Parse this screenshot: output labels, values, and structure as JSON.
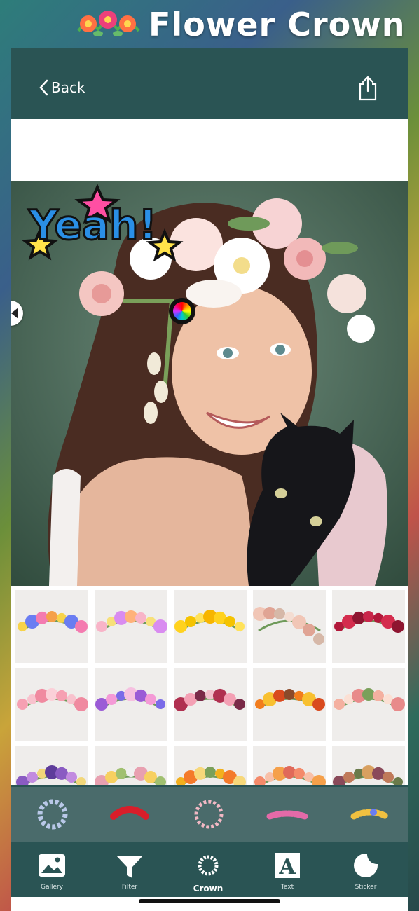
{
  "banner": {
    "title": "Flower Crown"
  },
  "header": {
    "back_label": "Back"
  },
  "colors": {
    "panel": "#2a5454",
    "category_bar": "#4a6b6b",
    "tile_bg": "#efedeb"
  },
  "icons": {
    "back": "chevron-left-icon",
    "share": "share-icon",
    "color_wheel": "color-wheel-icon",
    "handle": "caret-left-icon"
  },
  "sticker": {
    "text": "Yeah!"
  },
  "crown_grid": {
    "rows": 3,
    "columns": 5,
    "items": [
      {
        "name": "crown-mixed-blue"
      },
      {
        "name": "crown-pastel"
      },
      {
        "name": "crown-yellow"
      },
      {
        "name": "crown-pink-rose-side"
      },
      {
        "name": "crown-red-roses"
      },
      {
        "name": "crown-pink"
      },
      {
        "name": "crown-purple"
      },
      {
        "name": "crown-burgundy"
      },
      {
        "name": "crown-orange"
      },
      {
        "name": "crown-peach-roses"
      },
      {
        "name": "crown-violet"
      },
      {
        "name": "crown-wildflower"
      },
      {
        "name": "crown-sunflower"
      },
      {
        "name": "crown-coral"
      },
      {
        "name": "crown-autumn"
      }
    ]
  },
  "categories": [
    {
      "name": "blue-wreath"
    },
    {
      "name": "red-roses"
    },
    {
      "name": "pink-wreath"
    },
    {
      "name": "pastel-band"
    },
    {
      "name": "mixed-band"
    }
  ],
  "tabs": [
    {
      "label": "Gallery",
      "icon": "image-icon",
      "active": false
    },
    {
      "label": "Filter",
      "icon": "filter-icon",
      "active": false
    },
    {
      "label": "Crown",
      "icon": "wreath-icon",
      "active": true
    },
    {
      "label": "Text",
      "icon": "text-icon",
      "active": false
    },
    {
      "label": "Sticker",
      "icon": "sticker-icon",
      "active": false
    }
  ]
}
